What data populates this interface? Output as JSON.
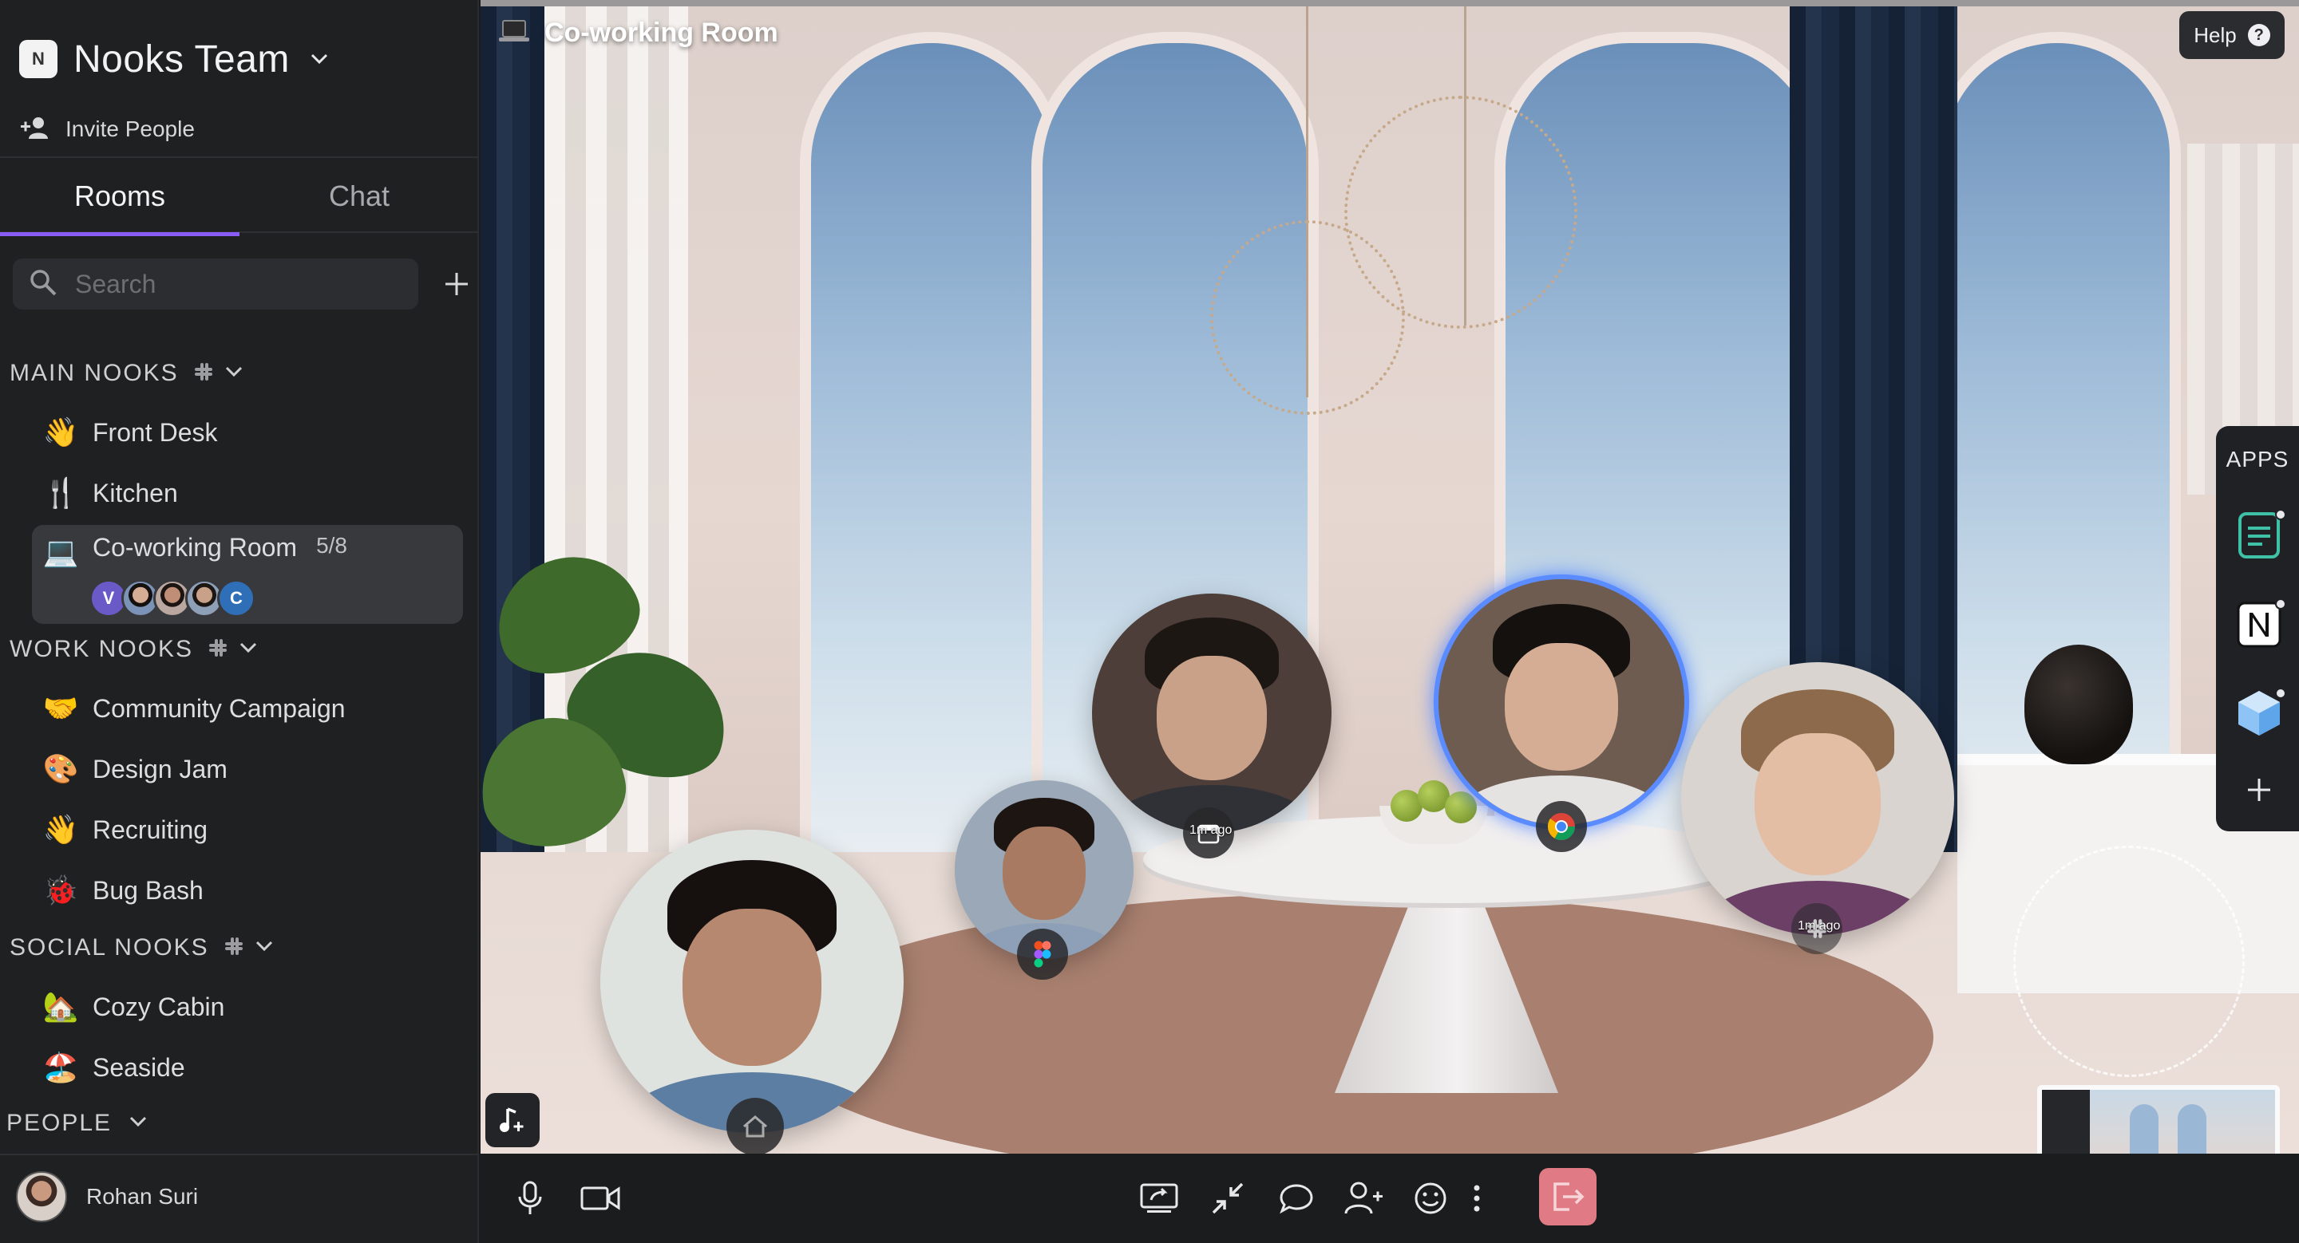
{
  "team": {
    "logo_letter": "N",
    "name": "Nooks Team"
  },
  "invite": {
    "label": "Invite People"
  },
  "tabs": [
    {
      "label": "Rooms",
      "active": true
    },
    {
      "label": "Chat",
      "active": false
    }
  ],
  "search": {
    "placeholder": "Search",
    "value": ""
  },
  "sections": {
    "main": {
      "title": "MAIN NOOKS",
      "rooms": [
        {
          "emoji": "👋",
          "label": "Front Desk"
        },
        {
          "emoji": "🍴",
          "label": "Kitchen"
        },
        {
          "emoji": "💻",
          "label": "Co-working Room",
          "count": "5/8",
          "active": true,
          "avatars": [
            "V",
            "",
            "",
            "",
            "C"
          ]
        }
      ]
    },
    "work": {
      "title": "WORK NOOKS",
      "rooms": [
        {
          "emoji": "🤝",
          "label": "Community Campaign"
        },
        {
          "emoji": "🎨",
          "label": "Design Jam"
        },
        {
          "emoji": "👋",
          "label": "Recruiting"
        },
        {
          "emoji": "🐞",
          "label": "Bug Bash"
        }
      ]
    },
    "social": {
      "title": "SOCIAL NOOKS",
      "rooms": [
        {
          "emoji": "🏡",
          "label": "Cozy Cabin"
        },
        {
          "emoji": "🏖️",
          "label": "Seaside"
        }
      ]
    },
    "people": {
      "title": "PEOPLE"
    }
  },
  "user": {
    "name": "Rohan Suri"
  },
  "stage": {
    "room_icon": "laptop-icon",
    "room_title": "Co-working Room",
    "help_label": "Help",
    "help_glyph": "?",
    "apps_title": "APPS",
    "participants": [
      {
        "id": "p1",
        "badge_icon": "calendar-icon",
        "badge_text": "1m ago",
        "skin": "#c9a088",
        "hair": "#1d1714",
        "shirt": "#2f3137"
      },
      {
        "id": "p2",
        "badge_icon": "chrome-icon",
        "badge_text": "",
        "skin": "#d5ad95",
        "hair": "#15110f",
        "shirt": "#e5e3e2",
        "speaking": true
      },
      {
        "id": "p3",
        "badge_icon": "figma-icon",
        "badge_text": "",
        "skin": "#a97a62",
        "hair": "#1c1512",
        "shirt": "#8ea0b8"
      },
      {
        "id": "p4",
        "badge_icon": "slack-icon",
        "badge_text": "1m ago",
        "skin": "#e3bda4",
        "hair": "#8d6a4b",
        "shirt": "#6b3f66"
      },
      {
        "id": "p5",
        "badge_icon": "home-icon",
        "badge_text": "",
        "skin": "#b78870",
        "hair": "#16110f",
        "shirt": "#5d7ea3"
      }
    ]
  },
  "controls": {
    "accent_leave": "#e07a85",
    "accent_tab": "#8a5cf6",
    "speaking_ring": "#5b8cff"
  }
}
